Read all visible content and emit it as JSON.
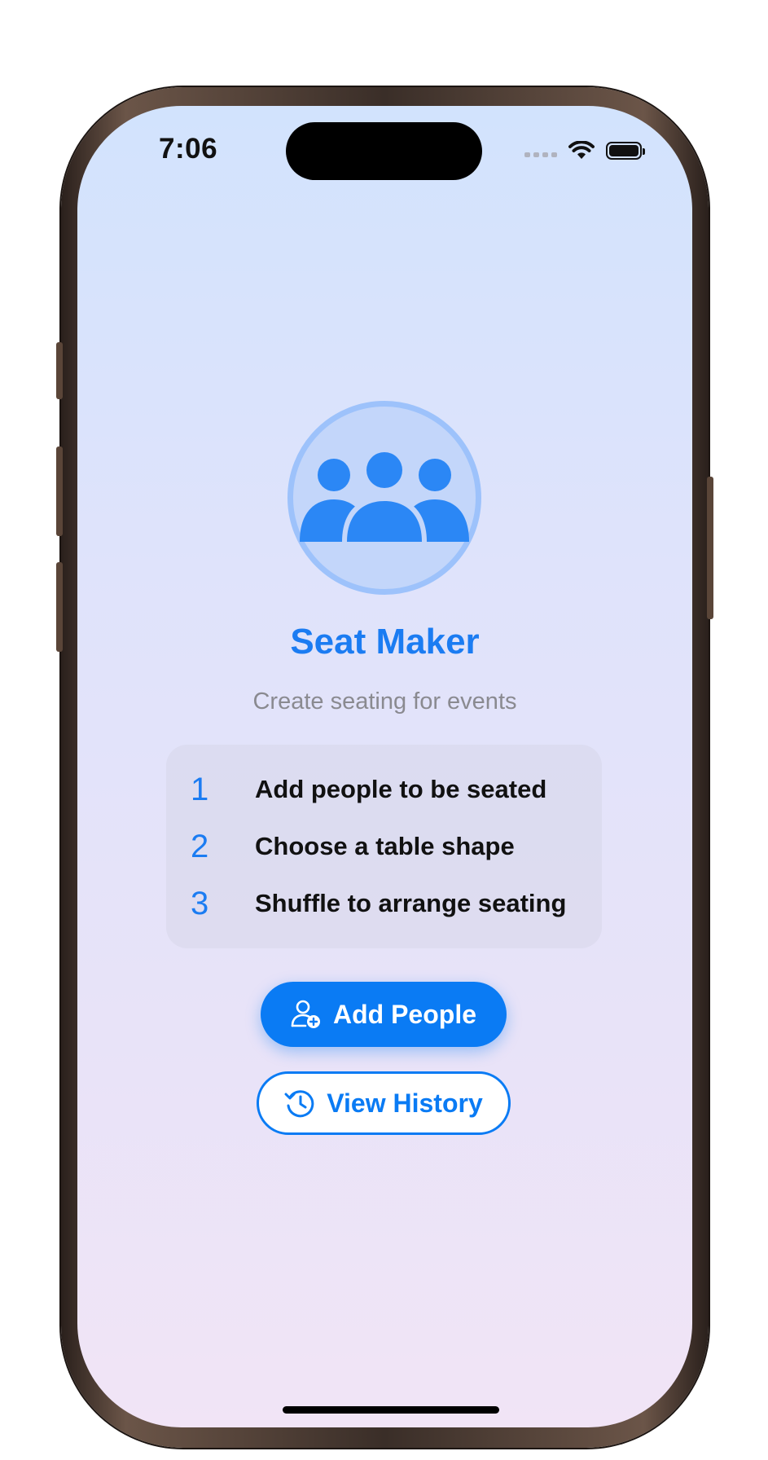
{
  "status_bar": {
    "time": "7:06",
    "icons": [
      "cellular-signal-icon",
      "wifi-icon",
      "battery-icon"
    ]
  },
  "app": {
    "logo_icon": "people-group-icon",
    "title": "Seat Maker",
    "subtitle": "Create seating for events"
  },
  "steps": [
    {
      "number": "1",
      "text": "Add people to be seated"
    },
    {
      "number": "2",
      "text": "Choose a table shape"
    },
    {
      "number": "3",
      "text": "Shuffle to arrange seating"
    }
  ],
  "buttons": {
    "add_people": {
      "label": "Add People",
      "icon": "person-add-icon"
    },
    "view_history": {
      "label": "View History",
      "icon": "clock-history-icon"
    }
  },
  "colors": {
    "accent": "#0A7BF4",
    "title": "#1B7CF2",
    "subtitle": "#8A8A90",
    "background_top": "#D2E3FD",
    "background_bottom": "#F1E4F6"
  }
}
